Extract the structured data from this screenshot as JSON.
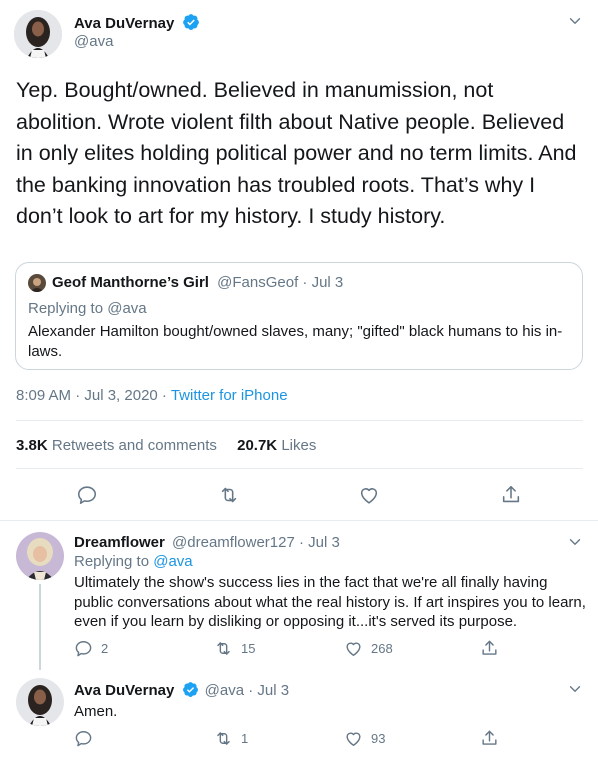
{
  "main_tweet": {
    "author_name": "Ava DuVernay",
    "author_handle": "@ava",
    "text": "Yep. Bought/owned. Believed in manumission, not abolition. Wrote violent filth about Native people. Believed in only elites holding political power and no term limits. And the banking innovation has troubled roots. That’s why I don’t look to art for my history. I study history.",
    "quoted": {
      "author_name": "Geof Manthorne’s Girl",
      "author_handle": "@FansGeof",
      "date": "· Jul 3",
      "replying_prefix": "Replying to",
      "replying_handle": "@ava",
      "text": "Alexander Hamilton bought/owned slaves, many; \"gifted\" black humans to his in-laws."
    },
    "timestamp": "8:09 AM · Jul 3, 2020 ·",
    "source": "Twitter for iPhone",
    "retweets_count": "3.8K",
    "retweets_label": "Retweets and comments",
    "likes_count": "20.7K",
    "likes_label": "Likes"
  },
  "replies": [
    {
      "author_name": "Dreamflower",
      "author_handle": "@dreamflower127",
      "date": "· Jul 3",
      "replying_prefix": "Replying to",
      "replying_handle": "@ava",
      "text": "Ultimately the show's success lies in the fact that we're all finally having public conversations about what the real history is. If art inspires you to learn, even if you learn by disliking or opposing it...it's served its purpose.",
      "reply_count": "2",
      "retweet_count": "15",
      "like_count": "268"
    },
    {
      "author_name": "Ava DuVernay",
      "author_handle": "@ava",
      "date": "· Jul 3",
      "text": "Amen.",
      "reply_count": "",
      "retweet_count": "1",
      "like_count": "93"
    }
  ],
  "colors": {
    "text": "#14171a",
    "muted": "#657786",
    "link": "#1b95e0",
    "verified": "#1da1f2",
    "divider": "#e6ecf0"
  },
  "icons": [
    "verified-badge-icon",
    "chevron-down-icon",
    "reply-icon",
    "retweet-icon",
    "like-icon",
    "share-icon"
  ]
}
